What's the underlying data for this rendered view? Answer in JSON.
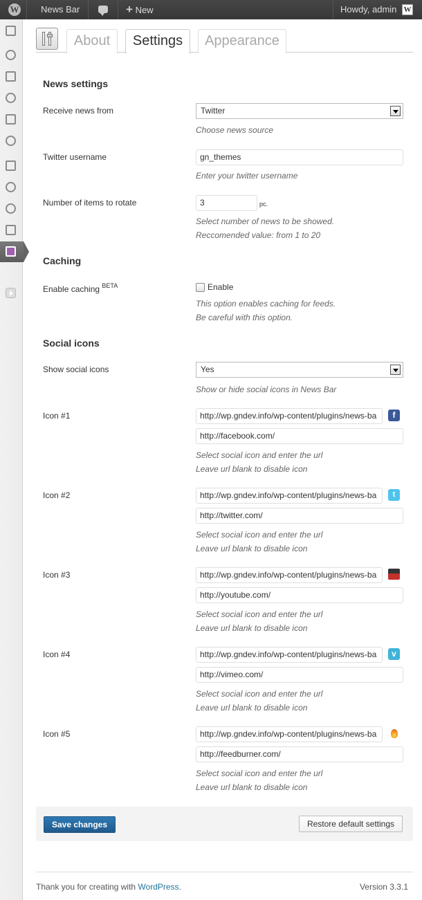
{
  "adminbar": {
    "site_name": "News Bar",
    "new_label": "New",
    "howdy": "Howdy, admin"
  },
  "sidebar": {
    "icons": [
      "dashboard-icon",
      "pin-icon",
      "media-icon",
      "links-icon",
      "pages-icon",
      "comments-icon",
      "appearance-icon",
      "plugins-icon",
      "users-icon",
      "tools-icon",
      "newsbar-icon"
    ],
    "active_index": 10
  },
  "tabs": [
    {
      "label": "About",
      "active": false
    },
    {
      "label": "Settings",
      "active": true
    },
    {
      "label": "Appearance",
      "active": false
    }
  ],
  "news": {
    "heading": "News settings",
    "source_label": "Receive news from",
    "source_value": "Twitter",
    "source_desc": "Choose news source",
    "username_label": "Twitter username",
    "username_value": "gn_themes",
    "username_desc": "Enter your twitter username",
    "items_label": "Number of items to rotate",
    "items_value": "3",
    "items_unit": "pc.",
    "items_desc1": "Select number of news to be showed.",
    "items_desc2": "Reccomended value: from 1 to 20"
  },
  "caching": {
    "heading": "Caching",
    "label": "Enable caching",
    "beta": "BETA",
    "checkbox_label": "Enable",
    "checked": false,
    "desc1": "This option enables caching for feeds.",
    "desc2": "Be careful with this option."
  },
  "social": {
    "heading": "Social icons",
    "show_label": "Show social icons",
    "show_value": "Yes",
    "show_desc": "Show or hide social icons in News Bar",
    "icon_desc1": "Select social icon and enter the url",
    "icon_desc2": "Leave url blank to disable icon",
    "icons": [
      {
        "label": "Icon #1",
        "icon_url": "http://wp.gndev.info/wp-content/plugins/news-ba",
        "url": "http://facebook.com/",
        "icon": "facebook-icon"
      },
      {
        "label": "Icon #2",
        "icon_url": "http://wp.gndev.info/wp-content/plugins/news-ba",
        "url": "http://twitter.com/",
        "icon": "twitter-icon"
      },
      {
        "label": "Icon #3",
        "icon_url": "http://wp.gndev.info/wp-content/plugins/news-ba",
        "url": "http://youtube.com/",
        "icon": "youtube-icon"
      },
      {
        "label": "Icon #4",
        "icon_url": "http://wp.gndev.info/wp-content/plugins/news-ba",
        "url": "http://vimeo.com/",
        "icon": "vimeo-icon"
      },
      {
        "label": "Icon #5",
        "icon_url": "http://wp.gndev.info/wp-content/plugins/news-ba",
        "url": "http://feedburner.com/",
        "icon": "feedburner-icon"
      }
    ]
  },
  "buttons": {
    "save": "Save changes",
    "restore": "Restore default settings"
  },
  "footer": {
    "thanks": "Thank you for creating with",
    "wp_link": "WordPress",
    "period": ".",
    "version": "Version 3.3.1"
  },
  "colors": {
    "primary_button": "#21598a",
    "link": "#21759b",
    "active_menu": "#5c5c5c"
  }
}
